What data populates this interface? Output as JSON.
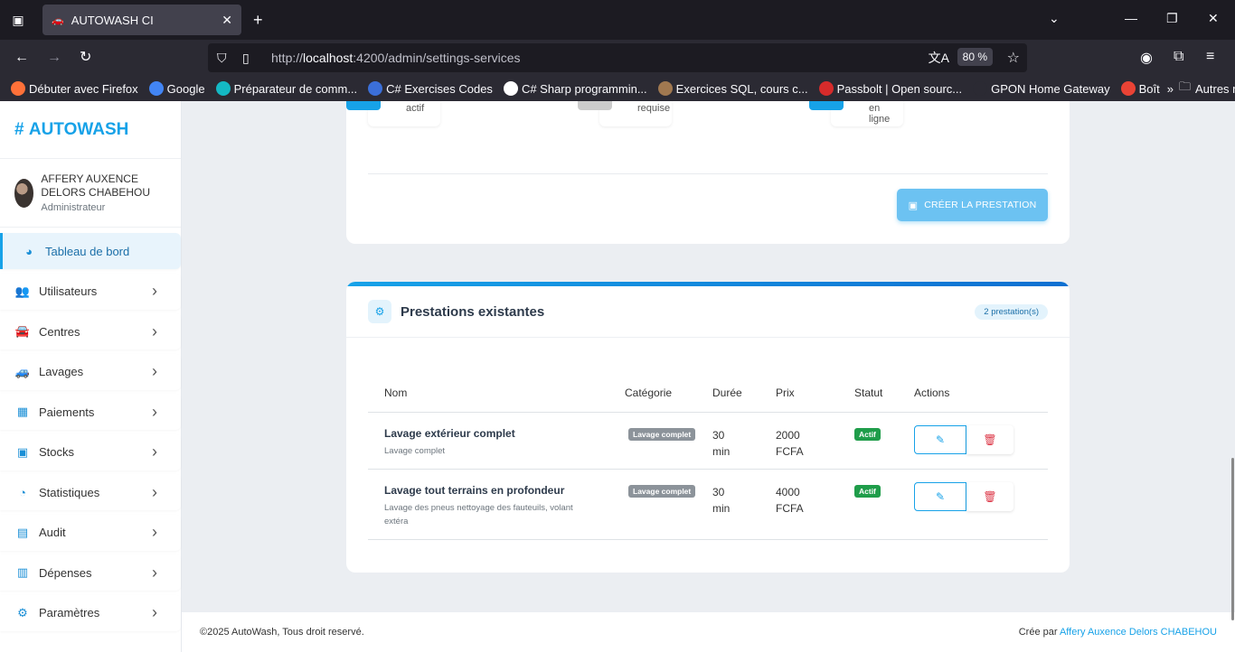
{
  "browser": {
    "tab_title": "AUTOWASH CI",
    "url_prefix": "http://",
    "url_host": "localhost",
    "url_path": ":4200/admin/settings-services",
    "zoom": "80 %",
    "bookmarks": [
      {
        "label": "Débuter avec Firefox",
        "icon": "firefox-icon",
        "color": "#ff7139"
      },
      {
        "label": "Google",
        "icon": "google-icon",
        "color": "#4285f4"
      },
      {
        "label": "Préparateur de comm...",
        "icon": "gem-icon",
        "color": "#14b8c4"
      },
      {
        "label": "C# Exercises Codes",
        "icon": "gear-icon",
        "color": "#3b6fd8"
      },
      {
        "label": "C# Sharp programmin...",
        "icon": "w3r-icon",
        "color": "#ffffff"
      },
      {
        "label": "Exercices SQL, cours c...",
        "icon": "image-icon",
        "color": "#a07850"
      },
      {
        "label": "Passbolt | Open sourc...",
        "icon": "passbolt-icon",
        "color": "#d62b2b"
      },
      {
        "label": "GPON Home Gateway",
        "icon": "globe-icon",
        "color": "#2b2a33"
      },
      {
        "label": "Boît",
        "icon": "gmail-icon",
        "color": "#ea4335"
      }
    ],
    "other_bookmarks": "Autres marque-pages"
  },
  "sidebar": {
    "brand": "AUTOWASH",
    "brand_hash": "#",
    "user_name": "AFFERY AUXENCE DELORS CHABEHOU",
    "user_role": "Administrateur",
    "items": [
      {
        "label": "Tableau de bord",
        "icon": "dashboard-icon"
      },
      {
        "label": "Utilisateurs",
        "icon": "users-icon"
      },
      {
        "label": "Centres",
        "icon": "car-icon"
      },
      {
        "label": "Lavages",
        "icon": "car-wash-icon"
      },
      {
        "label": "Paiements",
        "icon": "money-icon"
      },
      {
        "label": "Stocks",
        "icon": "box-icon"
      },
      {
        "label": "Statistiques",
        "icon": "pie-chart-icon"
      },
      {
        "label": "Audit",
        "icon": "clipboard-check-icon"
      },
      {
        "label": "Dépenses",
        "icon": "invoice-icon"
      },
      {
        "label": "Paramètres",
        "icon": "cogs-icon"
      }
    ]
  },
  "form": {
    "option1": "actif",
    "option2": "requise",
    "option3": "en ligne",
    "create_button": "CRÉER LA PRESTATION"
  },
  "services": {
    "title": "Prestations existantes",
    "count_badge": "2 prestation(s)",
    "columns": [
      "Nom",
      "Catégorie",
      "Durée",
      "Prix",
      "Statut",
      "Actions"
    ],
    "rows": [
      {
        "name": "Lavage extérieur complet",
        "description": "Lavage complet",
        "category": "Lavage complet",
        "duration_value": "30",
        "duration_unit": "min",
        "price_value": "2000",
        "price_unit": "FCFA",
        "status": "Actif"
      },
      {
        "name": "Lavage tout terrains en profondeur",
        "description": "Lavage des pneus nettoyage des fauteuils, volant extéra",
        "category": "Lavage complet",
        "duration_value": "30",
        "duration_unit": "min",
        "price_value": "4000",
        "price_unit": "FCFA",
        "status": "Actif"
      }
    ]
  },
  "footer": {
    "copyright": "©2025 AutoWash, Tous droit reservé.",
    "credit_prefix": "Crée par ",
    "credit_name": "Affery Auxence Delors CHABEHOU"
  },
  "colors": {
    "accent": "#17a2e8",
    "success": "#1f9d4a",
    "danger": "#dc3545"
  }
}
